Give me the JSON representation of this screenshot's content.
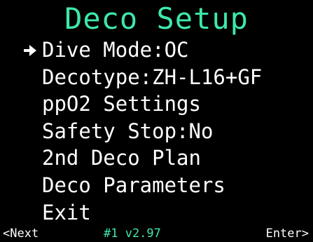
{
  "screen": {
    "title": "Deco Setup",
    "title_color": "#3ee9a8",
    "text_color": "#ffffff",
    "background_color": "#000000"
  },
  "menu": {
    "selected_index": 0,
    "cursor_icon": "right-arrow-icon",
    "items": [
      {
        "label": "Dive Mode:OC"
      },
      {
        "label": "Decotype:ZH-L16+GF"
      },
      {
        "label": "ppO2 Settings"
      },
      {
        "label": "Safety Stop:No"
      },
      {
        "label": "2nd Deco Plan"
      },
      {
        "label": "Deco Parameters"
      },
      {
        "label": "Exit"
      }
    ]
  },
  "footer": {
    "left": "<Next",
    "center": "#1 v2.97",
    "right": "Enter>"
  }
}
